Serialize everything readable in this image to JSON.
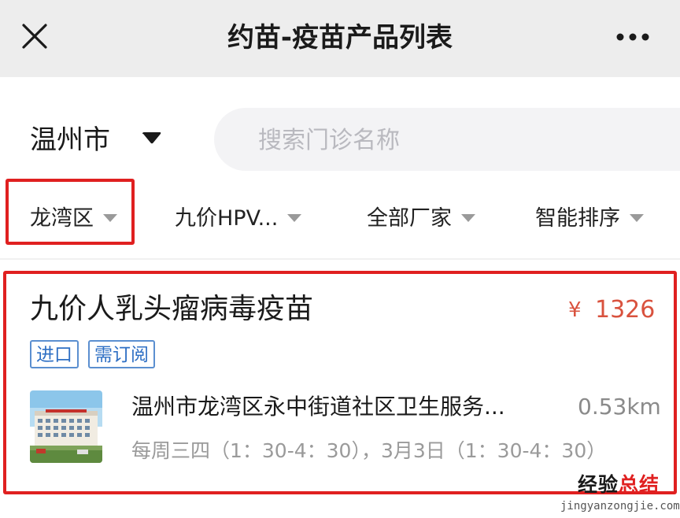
{
  "titlebar": {
    "title": "约苗-疫苗产品列表",
    "close_icon": "close-icon",
    "more_icon": "more-horizontal-icon"
  },
  "location": {
    "city": "温州市",
    "caret_icon": "caret-down-icon"
  },
  "search": {
    "placeholder": "搜索门诊名称",
    "value": ""
  },
  "filters": [
    {
      "label": "龙湾区",
      "highlighted": true
    },
    {
      "label": "九价HPV..."
    },
    {
      "label": "全部厂家"
    },
    {
      "label": "智能排序"
    }
  ],
  "product": {
    "name": "九价人乳头瘤病毒疫苗",
    "currency": "¥",
    "price": "1326",
    "tags": [
      "进口",
      "需订阅"
    ],
    "clinic": {
      "name": "温州市龙湾区永中街道社区卫生服务...",
      "distance": "0.53km",
      "schedule": "每周三四（1：30-4：30），3月3日（1：30-4：30）",
      "thumbnail": "clinic-building-photo"
    }
  },
  "watermark": {
    "title_black": "经验",
    "title_red": "总结",
    "url": "jingyanzongjie.com"
  },
  "colors": {
    "price": "#d9523e",
    "tag_border": "#5b8fd0",
    "highlight_box": "#e02020",
    "titlebar_bg": "#ededed"
  }
}
